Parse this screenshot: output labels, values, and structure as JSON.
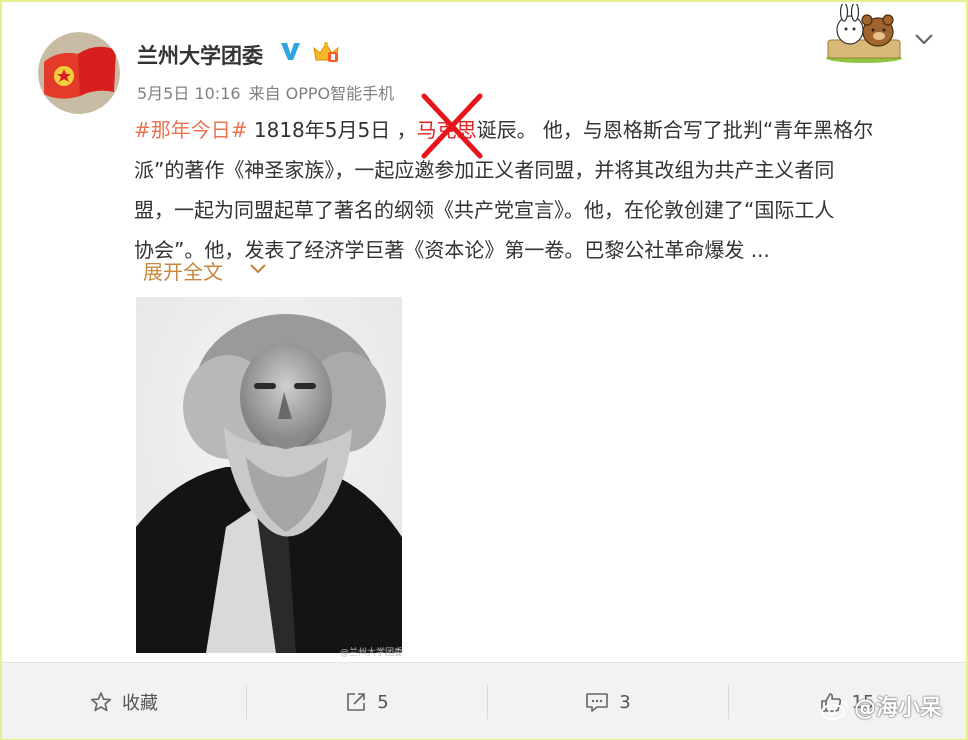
{
  "post": {
    "author": "兰州大学团委",
    "time": "5月5日 10:16",
    "source": "来自 OPPO智能手机",
    "hashtag": "#那年今日#",
    "segments": [
      " 1818年5月5日 ，",
      "马克思",
      "诞辰。 他，与恩格斯合写了批判“青年黑格尔"
    ],
    "lines": [
      "派”的著作《神圣家族》，一起应邀参加正义者同盟，并将其改组为共产主义者同",
      "盟，一起为同盟起草了著名的纲领《共产党宣言》。他，在伦敦创建了“国际工人",
      "协会”。他，发表了经济学巨著《资本论》第一卷。巴黎公社革命爆发 ..."
    ],
    "expand_label": "展开全文",
    "image_caption": "@兰州大学团委"
  },
  "actions": {
    "favorite": "收藏",
    "repost": "5",
    "comment": "3",
    "like": "15"
  },
  "watermark": "@海小呆",
  "colors": {
    "hashtag": "#eb7350",
    "highlight": "#e02020",
    "expand": "#c8873f",
    "verified": "#2ea7e0",
    "cross": "#e8141c"
  }
}
